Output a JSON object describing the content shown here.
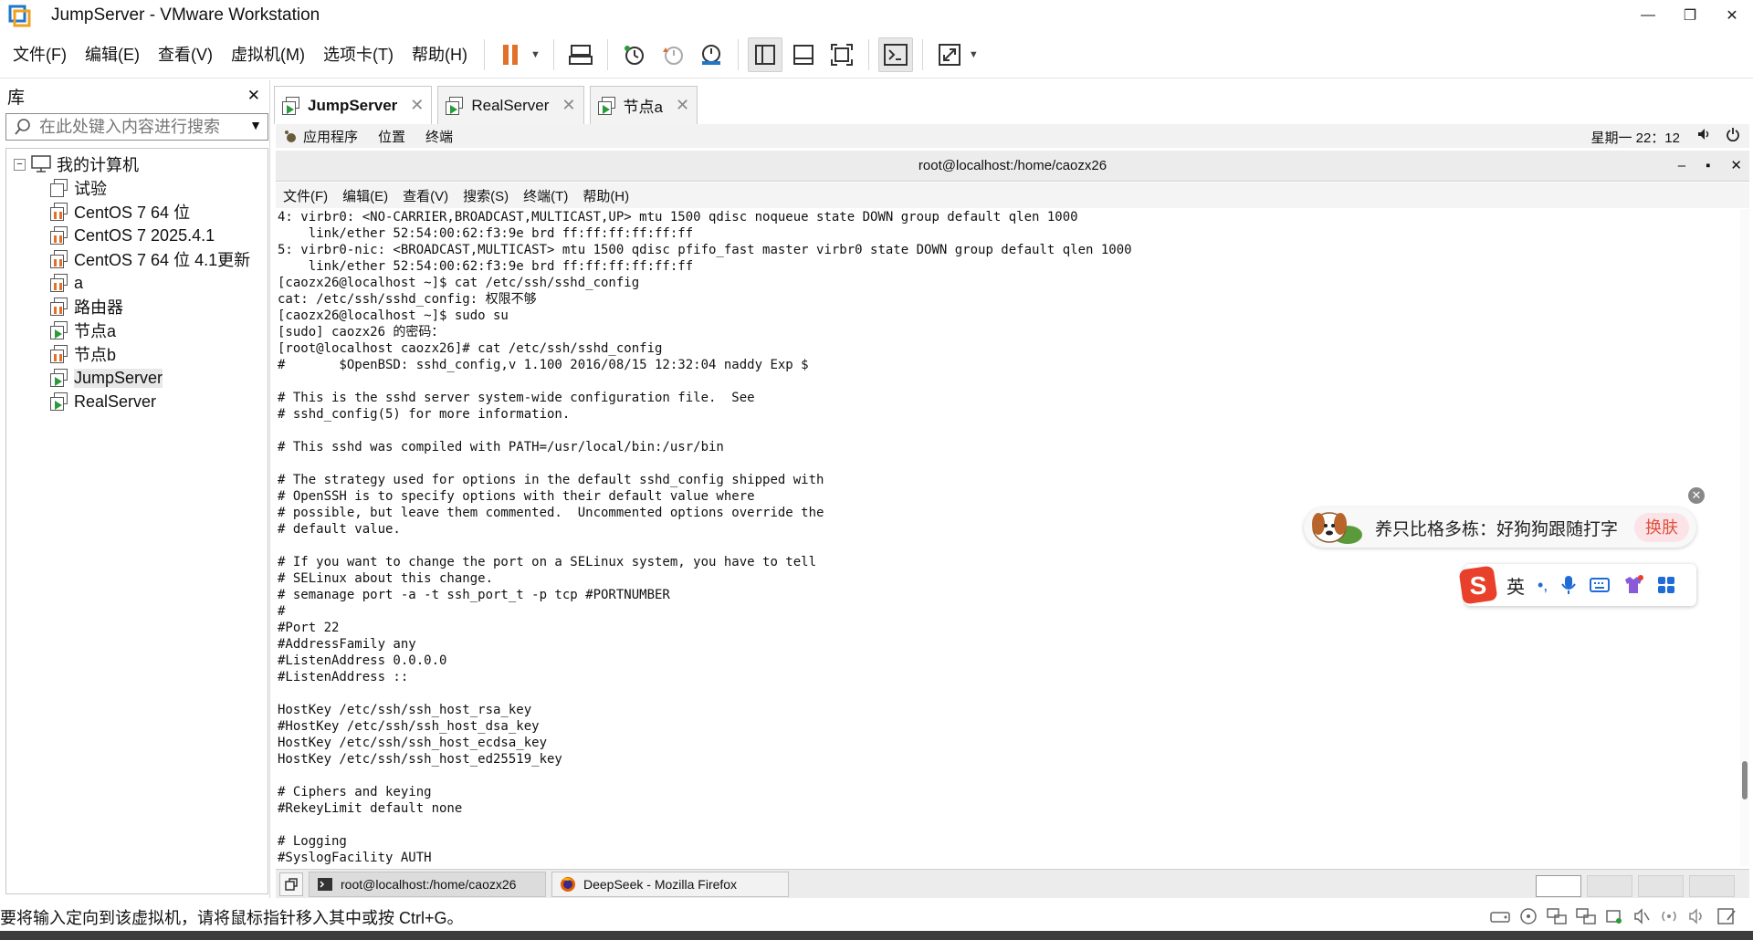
{
  "window": {
    "title": "JumpServer - VMware Workstation",
    "controls": [
      "—",
      "❐",
      "✕"
    ]
  },
  "menu": [
    "文件(F)",
    "编辑(E)",
    "查看(V)",
    "虚拟机(M)",
    "选项卡(T)",
    "帮助(H)"
  ],
  "library": {
    "title": "库",
    "close": "✕",
    "search_placeholder": "在此处键入内容进行搜索",
    "root": "我的计算机",
    "expander": "−",
    "items": [
      {
        "label": "试验",
        "state": "off"
      },
      {
        "label": "CentOS 7 64 位",
        "state": "paused"
      },
      {
        "label": "CentOS 7 2025.4.1",
        "state": "paused"
      },
      {
        "label": "CentOS 7 64 位 4.1更新",
        "state": "paused"
      },
      {
        "label": "a",
        "state": "paused"
      },
      {
        "label": "路由器",
        "state": "paused"
      },
      {
        "label": "节点a",
        "state": "running"
      },
      {
        "label": "节点b",
        "state": "paused"
      },
      {
        "label": "JumpServer",
        "state": "running",
        "selected": true
      },
      {
        "label": "RealServer",
        "state": "running"
      }
    ]
  },
  "tabs": [
    {
      "label": "JumpServer",
      "active": true,
      "close": "✕"
    },
    {
      "label": "RealServer",
      "active": false,
      "close": "✕"
    },
    {
      "label": "节点a",
      "active": false,
      "close": "✕"
    }
  ],
  "gnome": {
    "apps": "应用程序",
    "places": "位置",
    "terminal": "终端",
    "clock": "星期一 22：12"
  },
  "terminal": {
    "title": "root@localhost:/home/caozx26",
    "controls": [
      "–",
      "▪",
      "✕"
    ],
    "menu": [
      "文件(F)",
      "编辑(E)",
      "查看(V)",
      "搜索(S)",
      "终端(T)",
      "帮助(H)"
    ],
    "lines": [
      "4: virbr0: <NO-CARRIER,BROADCAST,MULTICAST,UP> mtu 1500 qdisc noqueue state DOWN group default qlen 1000",
      "    link/ether 52:54:00:62:f3:9e brd ff:ff:ff:ff:ff:ff",
      "5: virbr0-nic: <BROADCAST,MULTICAST> mtu 1500 qdisc pfifo_fast master virbr0 state DOWN group default qlen 1000",
      "    link/ether 52:54:00:62:f3:9e brd ff:ff:ff:ff:ff:ff",
      "[caozx26@localhost ~]$ cat /etc/ssh/sshd_config",
      "cat: /etc/ssh/sshd_config: 权限不够",
      "[caozx26@localhost ~]$ sudo su",
      "[sudo] caozx26 的密码：",
      "[root@localhost caozx26]# cat /etc/ssh/sshd_config",
      "#       $OpenBSD: sshd_config,v 1.100 2016/08/15 12:32:04 naddy Exp $",
      "",
      "# This is the sshd server system-wide configuration file.  See",
      "# sshd_config(5) for more information.",
      "",
      "# This sshd was compiled with PATH=/usr/local/bin:/usr/bin",
      "",
      "# The strategy used for options in the default sshd_config shipped with",
      "# OpenSSH is to specify options with their default value where",
      "# possible, but leave them commented.  Uncommented options override the",
      "# default value.",
      "",
      "# If you want to change the port on a SELinux system, you have to tell",
      "# SELinux about this change.",
      "# semanage port -a -t ssh_port_t -p tcp #PORTNUMBER",
      "#",
      "#Port 22",
      "#AddressFamily any",
      "#ListenAddress 0.0.0.0",
      "#ListenAddress ::",
      "",
      "HostKey /etc/ssh/ssh_host_rsa_key",
      "#HostKey /etc/ssh/ssh_host_dsa_key",
      "HostKey /etc/ssh/ssh_host_ecdsa_key",
      "HostKey /etc/ssh/ssh_host_ed25519_key",
      "",
      "# Ciphers and keying",
      "#RekeyLimit default none",
      "",
      "# Logging",
      "#SyslogFacility AUTH"
    ]
  },
  "ime": {
    "tip": "养只比格多栋：好狗狗跟随打字",
    "swap": "换肤",
    "mode": "英",
    "punct": "•,",
    "close": "✕"
  },
  "guest_taskbar": [
    {
      "label": "root@localhost:/home/caozx26",
      "icon": "terminal-icon"
    },
    {
      "label": "DeepSeek - Mozilla Firefox",
      "icon": "firefox-icon"
    }
  ],
  "status": {
    "message": "要将输入定向到该虚拟机，请将鼠标指针移入其中或按 Ctrl+G。"
  },
  "colors": {
    "pause_orange": "#e0702a",
    "run_green": "#2a9a3a",
    "ime_red": "#e0503a"
  }
}
